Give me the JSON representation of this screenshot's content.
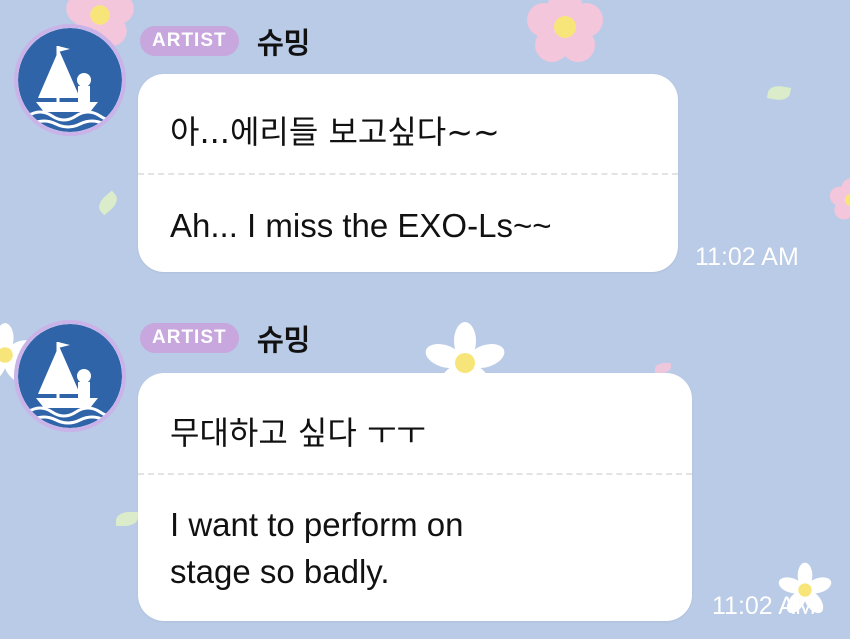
{
  "theme": {
    "background": "#b9cbe6",
    "badge_color": "#c7a7de",
    "bubble_color": "#ffffff"
  },
  "messages": [
    {
      "badge": "ARTIST",
      "sender": "슈밍",
      "korean": "아...에리들 보고싶다~~",
      "english": "Ah... I miss the EXO-Ls~~",
      "time": "11:02 AM"
    },
    {
      "badge": "ARTIST",
      "sender": "슈밍",
      "korean": "무대하고 싶다 ㅜㅜ",
      "english_lines": [
        "I want to perform on",
        "stage so badly."
      ],
      "time": "11:02 AM"
    }
  ],
  "avatar_icon": "ship-sailor-avatar-icon"
}
